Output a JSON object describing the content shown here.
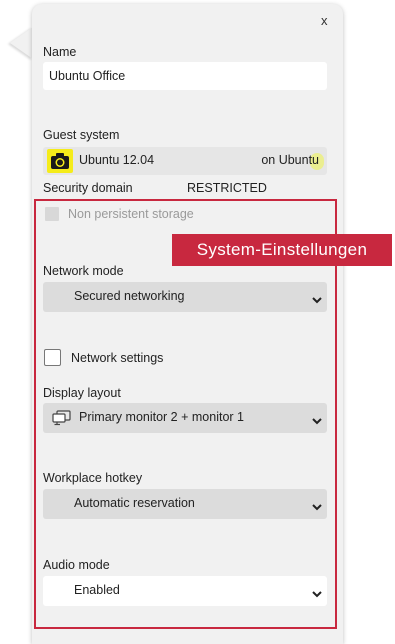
{
  "dialog": {
    "close_label": "x"
  },
  "name": {
    "label": "Name",
    "value": "Ubuntu Office"
  },
  "guest_system": {
    "label": "Guest system",
    "os": "Ubuntu 12.04",
    "host": "on Ubuntu",
    "icon": "camera-icon"
  },
  "security_domain": {
    "label": "Security domain",
    "value": "RESTRICTED"
  },
  "non_persistent": {
    "label": "Non persistent storage",
    "checked": false,
    "disabled": true
  },
  "callout": {
    "text": "System-Einstellungen",
    "color": "#c8283f"
  },
  "network_mode": {
    "label": "Network mode",
    "value": "Secured networking"
  },
  "network_settings": {
    "label": "Network settings",
    "checked": false
  },
  "display_layout": {
    "label": "Display layout",
    "value": "Primary monitor 2 + monitor 1",
    "icon": "monitor-icon"
  },
  "workplace_hotkey": {
    "label": "Workplace hotkey",
    "value": "Automatic reservation"
  },
  "audio_mode": {
    "label": "Audio mode",
    "value": "Enabled"
  }
}
